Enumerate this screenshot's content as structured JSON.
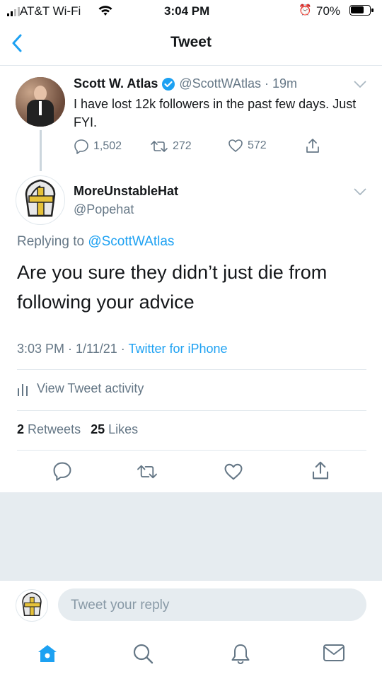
{
  "status_bar": {
    "carrier": "AT&T Wi-Fi",
    "time": "3:04 PM",
    "battery": "70%"
  },
  "nav": {
    "title": "Tweet"
  },
  "parent_tweet": {
    "name": "Scott W. Atlas",
    "handle": "@ScottWAtlas",
    "time": "· 19m",
    "text": "I have lost 12k followers in the past few days. Just FYI.",
    "replies": "1,502",
    "retweets": "272",
    "likes": "572"
  },
  "main_tweet": {
    "name": "MoreUnstableHat",
    "handle": "@Popehat",
    "replying_prefix": "Replying to",
    "replying_handle": "@ScottWAtlas",
    "text": "Are you sure they didn’t just die from following your advice",
    "timestamp": "3:03 PM · 1/11/21 ·",
    "source": "Twitter for iPhone",
    "activity": "View Tweet activity",
    "retweets_count": "2",
    "retweets_label": "Retweets",
    "likes_count": "25",
    "likes_label": "Likes"
  },
  "reply_bar": {
    "placeholder": "Tweet your reply"
  },
  "tab_bar": {
    "items": [
      "home-icon",
      "search-icon",
      "notifications-icon",
      "messages-icon"
    ]
  },
  "colors": {
    "accent": "#1da1f2",
    "gray": "#657786",
    "divider": "#e1e8ed"
  }
}
